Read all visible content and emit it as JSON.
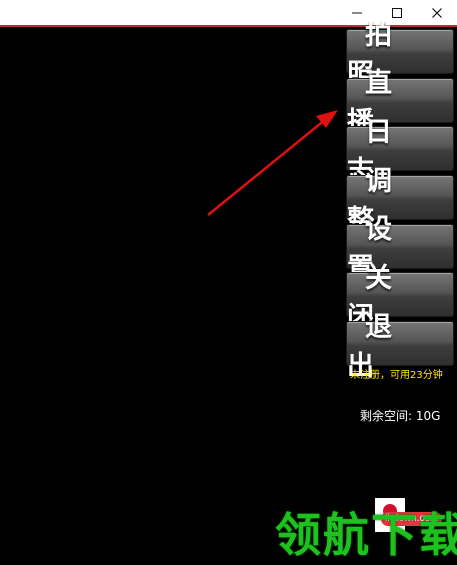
{
  "window": {
    "minimize_label": "—",
    "maximize_label": "☐",
    "close_label": "✕"
  },
  "panel": {
    "buttons": [
      {
        "label": "拍照"
      },
      {
        "label": "直播"
      },
      {
        "label": "日志"
      },
      {
        "label": "调整"
      },
      {
        "label": "设置"
      },
      {
        "label": "关闭"
      },
      {
        "label": "退出"
      }
    ]
  },
  "status": {
    "registration": "未注册，可用23分钟",
    "free_space": "剩余空间: 10G"
  },
  "watermark": {
    "site": "lhdown.com",
    "name": "领航下载"
  },
  "colors": {
    "titlebar_accent": "#c0283a",
    "arrow": "#e01010",
    "registration_text": "#ffeb00",
    "watermark_green": "#1ec21e"
  },
  "icons": {
    "arrow": "red-arrow-annotation",
    "minimize": "minimize-icon",
    "maximize": "maximize-icon",
    "close": "close-icon"
  }
}
